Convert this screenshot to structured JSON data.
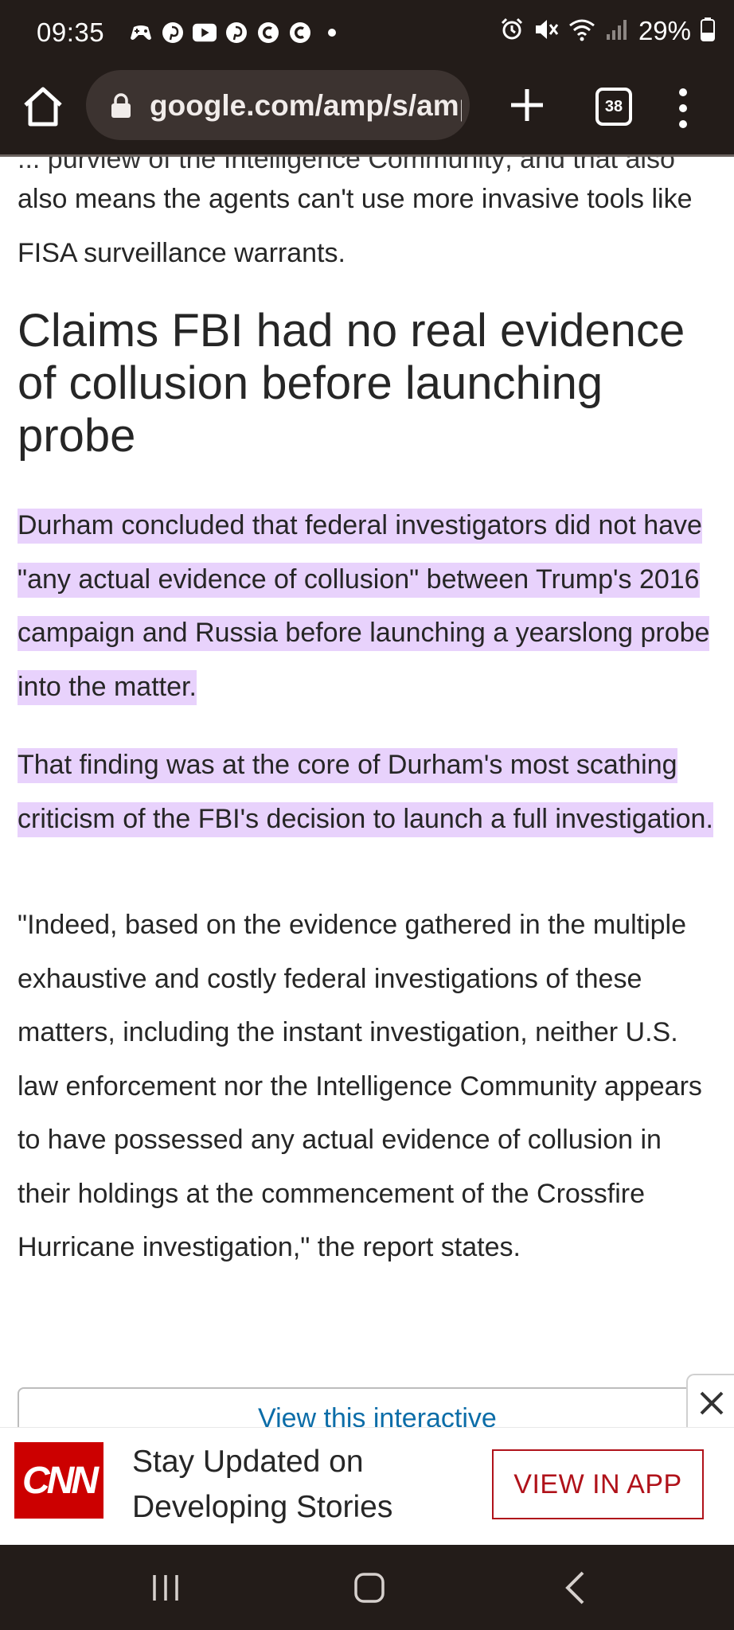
{
  "status_bar": {
    "time": "09:35",
    "notification_icons": [
      "game-controller-icon",
      "pinterest-icon",
      "youtube-icon",
      "pinterest-icon",
      "c-app-icon",
      "c-app-icon",
      "dot-icon"
    ],
    "system_icons": [
      "alarm-icon",
      "mute-icon",
      "wifi-icon",
      "signal-icon"
    ],
    "battery_percent": "29%"
  },
  "browser": {
    "url": "google.com/amp/s/amp",
    "tab_count": "38"
  },
  "article": {
    "cutoff_line": "... purview of the Intelligence Community; and that also",
    "para1": "also means the agents can't use more invasive tools like FISA surveillance warrants.",
    "heading": "Claims FBI had no real evidence of collusion before launching probe",
    "para2": "Durham concluded that federal investigators did not have \"any actual evidence of collusion\" between Trump's 2016 campaign and Russia before launching a yearslong probe into the matter.",
    "para3": "That finding was at the core of Durham's most scathing criticism of the FBI's decision to launch a full investigation.",
    "para4": "\"Indeed, based on the evidence gathered in the multiple exhaustive and costly federal investigations of these matters, including the instant investigation, neither U.S. law enforcement nor the Intelligence Community appears to have possessed any actual evidence of collusion in their holdings at the commencement of the Crossfire Hurricane investigation,\" the report states.",
    "interactive_link": "View this interactive"
  },
  "app_banner": {
    "logo_text": "CNN",
    "message": "Stay Updated on Developing Stories",
    "button_label": "VIEW IN APP"
  },
  "colors": {
    "chrome_background": "#231c19",
    "highlight": "#e8d2fc",
    "cnn_red": "#cc0000",
    "button_red": "#b0121a",
    "link_blue": "#0c6da8"
  }
}
